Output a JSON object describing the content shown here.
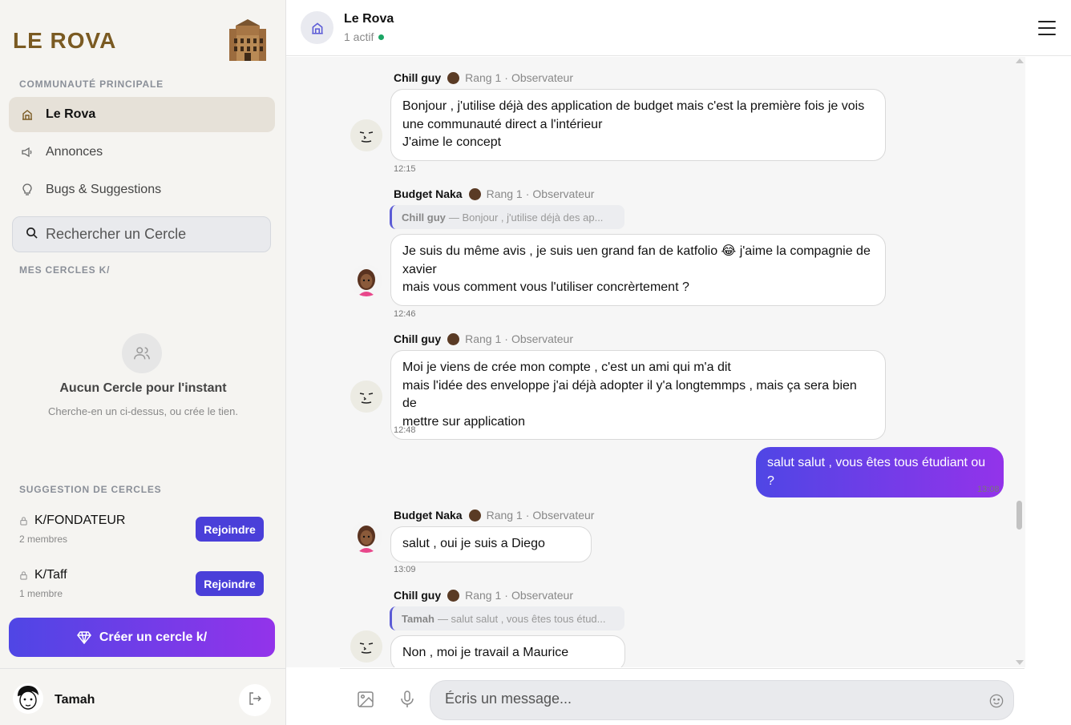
{
  "sidebar": {
    "brand": "LE ROVA",
    "main_section_label": "COMMUNAUTÉ PRINCIPALE",
    "nav": [
      {
        "label": "Le Rova",
        "icon": "building-icon",
        "active": true
      },
      {
        "label": "Annonces",
        "icon": "megaphone-icon",
        "active": false
      },
      {
        "label": "Bugs & Suggestions",
        "icon": "lightbulb-icon",
        "active": false
      }
    ],
    "search_placeholder": "Rechercher un Cercle",
    "my_circles_label": "MES CERCLES K/",
    "empty_title": "Aucun Cercle pour l'instant",
    "empty_subtitle": "Cherche-en un ci-dessus, ou crée le tien.",
    "suggestions_label": "SUGGESTION DE CERCLES",
    "suggestions": [
      {
        "name": "K/FONDATEUR",
        "members": "2 membres",
        "join_label": "Rejoindre"
      },
      {
        "name": "K/Taff",
        "members": "1 membre",
        "join_label": "Rejoindre"
      }
    ],
    "create_label": "Créer un cercle k/",
    "user_name": "Tamah"
  },
  "header": {
    "title": "Le Rova",
    "status": "1 actif"
  },
  "messages": [
    {
      "author": "Chill guy",
      "rank": "Rang 1",
      "role": "Observateur",
      "lines": [
        "Bonjour , j'utilise déjà des application de budget mais c'est la première fois je vois",
        "une communauté direct a l'intérieur",
        "J'aime le concept"
      ],
      "time": "12:15"
    },
    {
      "author": "Budget Naka",
      "rank": "Rang 1",
      "role": "Observateur",
      "reply_author": "Chill guy",
      "reply_text": "— Bonjour , j'utilise déjà des ap...",
      "lines": [
        "Je suis du même avis , je suis uen grand fan de katfolio 😂 j'aime la compagnie de",
        "xavier",
        "mais vous comment vous l'utiliser concrèrtement ?"
      ],
      "time": "12:46"
    },
    {
      "author": "Chill guy",
      "rank": "Rang 1",
      "role": "Observateur",
      "lines": [
        "Moi je viens de crée mon compte , c'est un ami qui m'a dit",
        "mais l'idée des enveloppe j'ai déjà adopter il y'a longtemmps , mais ça sera bien de",
        "mettre sur application"
      ],
      "time": "12:48"
    },
    {
      "author": "",
      "mine": true,
      "lines": [
        "salut salut , vous êtes tous étudiant ou ?"
      ],
      "time": "13:08"
    },
    {
      "author": "Budget Naka",
      "rank": "Rang 1",
      "role": "Observateur",
      "lines": [
        "salut , oui je suis a Diego"
      ],
      "time": "13:09"
    },
    {
      "author": "Chill guy",
      "rank": "Rang 1",
      "role": "Observateur",
      "reply_author": "Tamah",
      "reply_text": "— salut salut , vous êtes tous étud...",
      "lines": [
        "Non , moi je travail a Maurice"
      ],
      "time": ""
    }
  ],
  "composer": {
    "placeholder": "Écris un message..."
  },
  "colors": {
    "brand": "#7a5a22",
    "accent": "#4f46e5",
    "accent_end": "#9333ea",
    "online": "#1aa564"
  }
}
